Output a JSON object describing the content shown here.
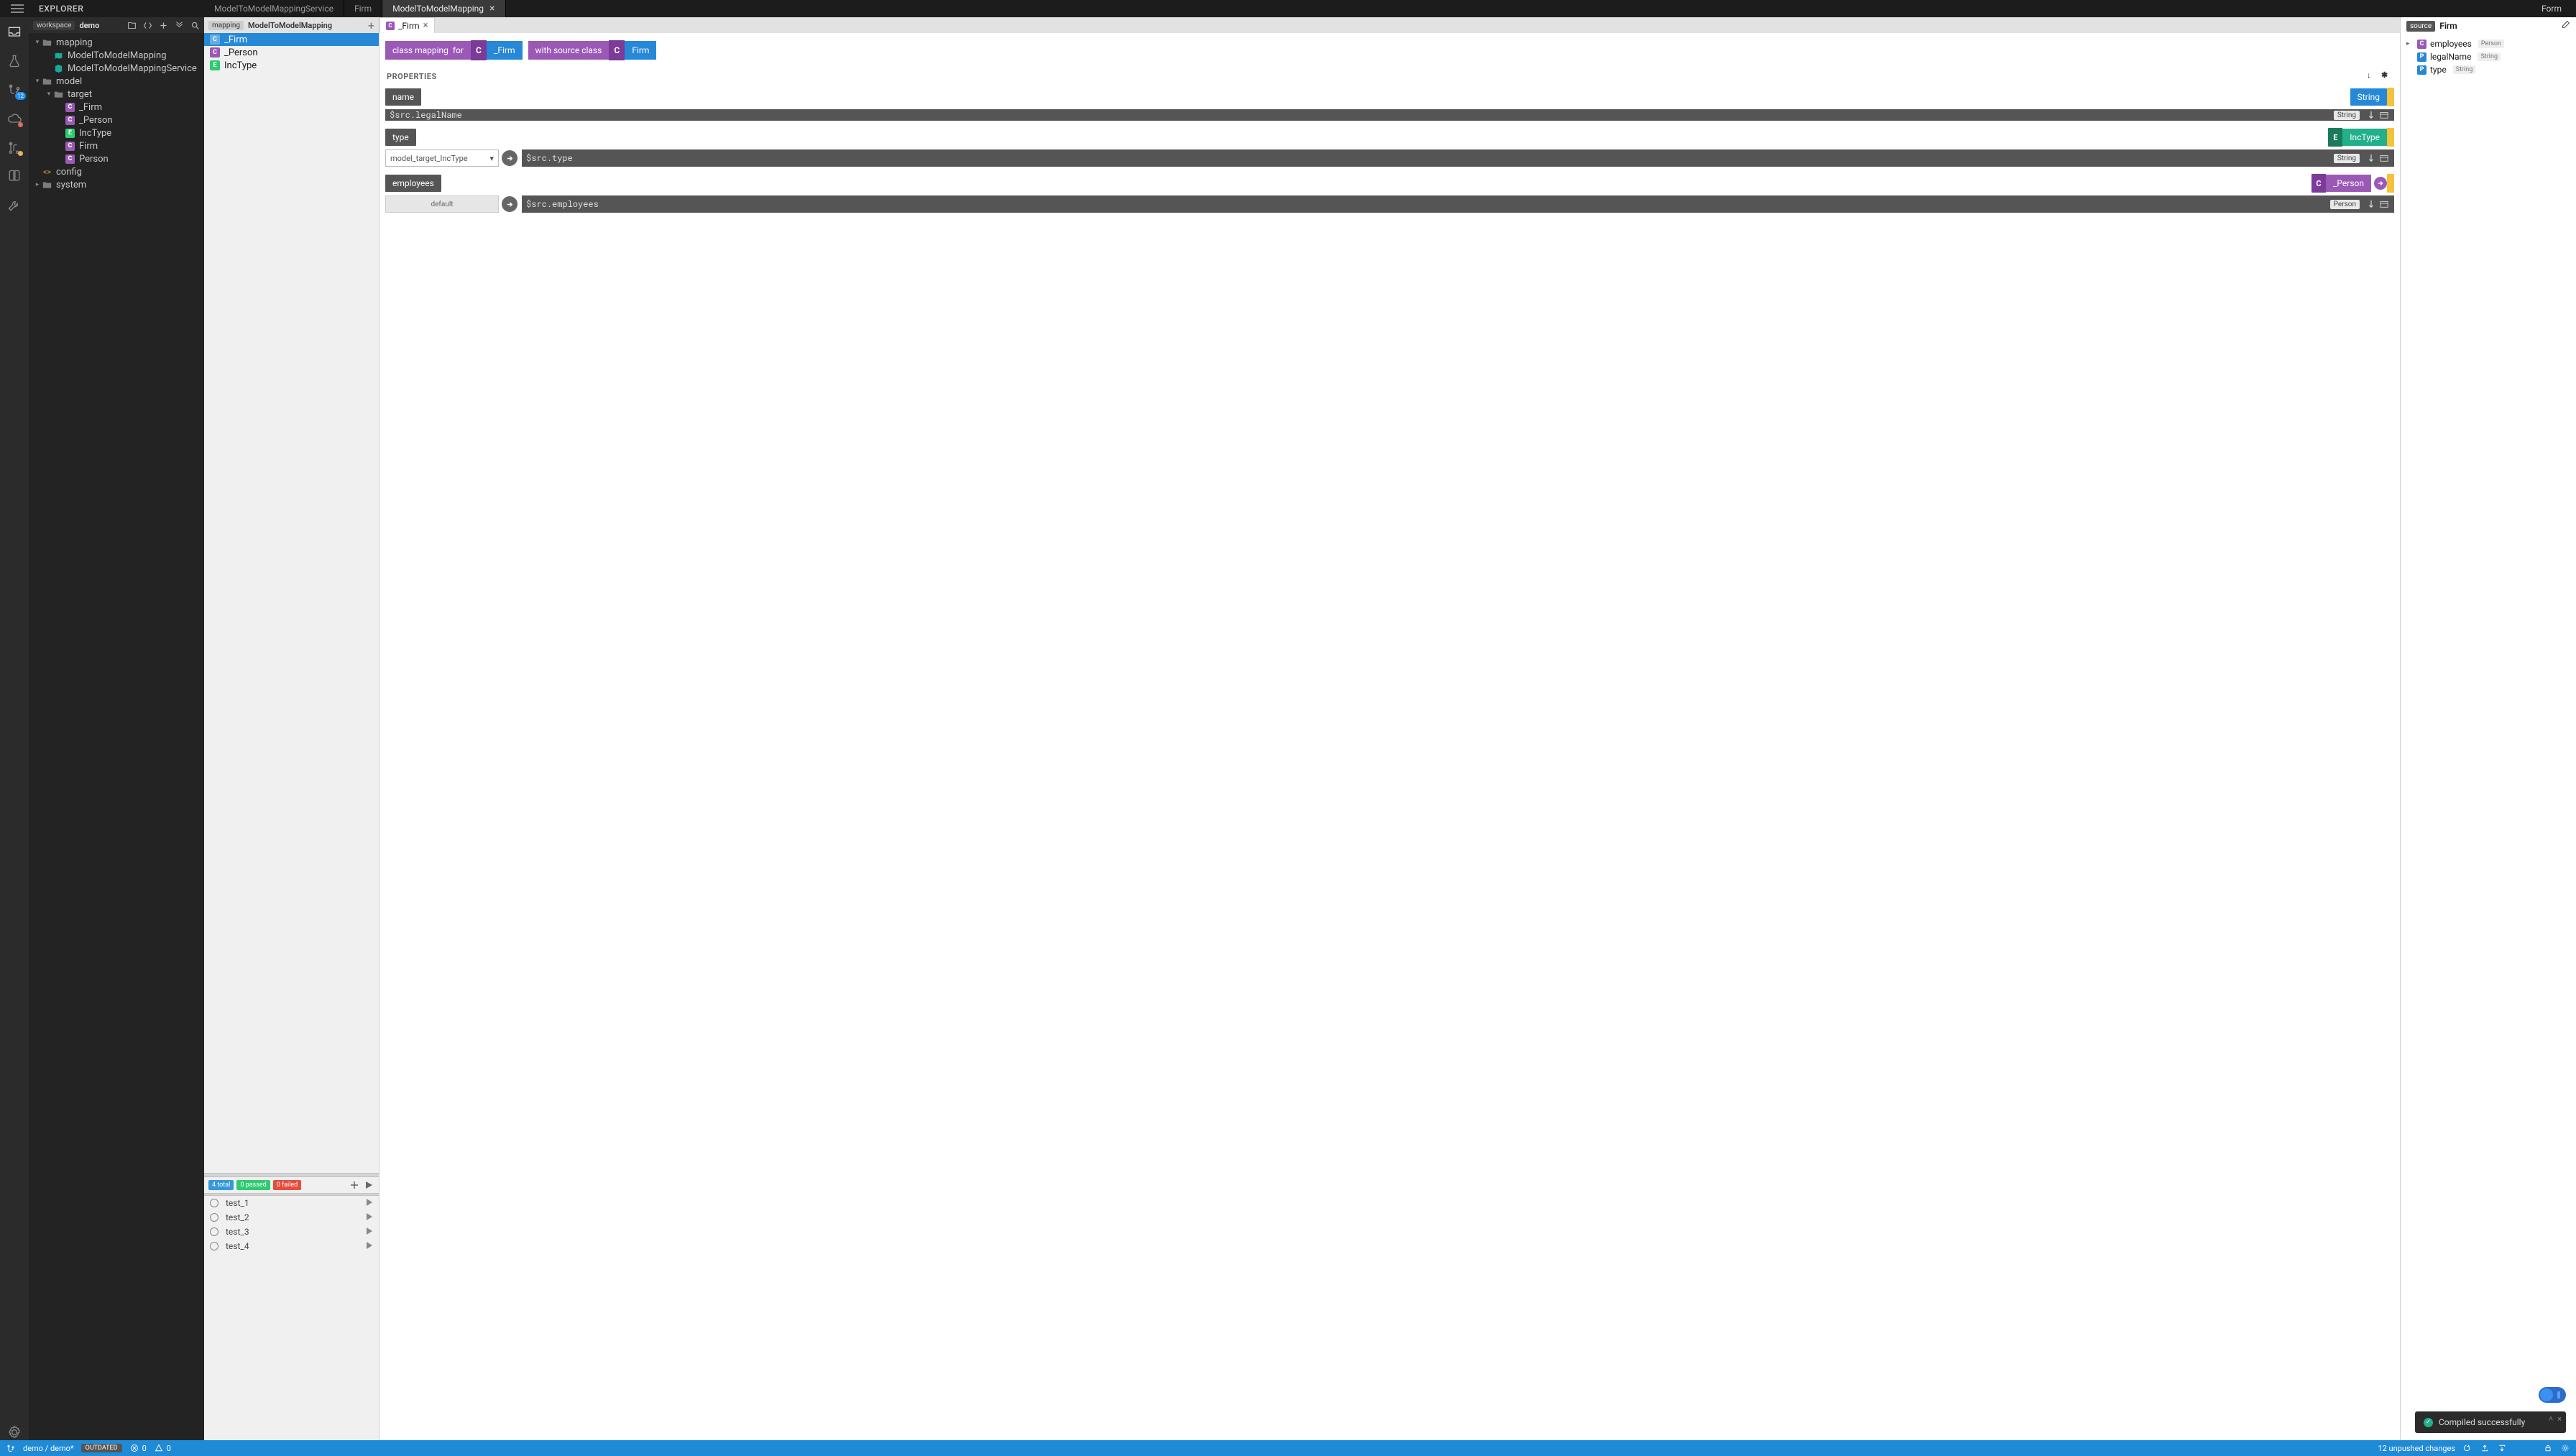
{
  "tabstrip": {
    "explorer_label": "EXPLORER",
    "tabs": [
      {
        "label": "ModelToModelMappingService",
        "active": false,
        "closeable": false
      },
      {
        "label": "Firm",
        "active": false,
        "closeable": false
      },
      {
        "label": "ModelToModelMapping",
        "active": true,
        "closeable": true
      }
    ],
    "right_label": "Form"
  },
  "workspace": {
    "pill": "workspace",
    "name": "demo"
  },
  "explorer_tree": [
    {
      "depth": 0,
      "twisty": "▾",
      "icon": "folder",
      "label": "mapping"
    },
    {
      "depth": 1,
      "twisty": "",
      "icon": "map",
      "label": "ModelToModelMapping"
    },
    {
      "depth": 1,
      "twisty": "",
      "icon": "svc",
      "label": "ModelToModelMappingService"
    },
    {
      "depth": 0,
      "twisty": "▾",
      "icon": "folder",
      "label": "model"
    },
    {
      "depth": 1,
      "twisty": "▾",
      "icon": "folder",
      "label": "target"
    },
    {
      "depth": 2,
      "twisty": "",
      "icon": "C",
      "label": "_Firm"
    },
    {
      "depth": 2,
      "twisty": "",
      "icon": "C",
      "label": "_Person"
    },
    {
      "depth": 2,
      "twisty": "",
      "icon": "E",
      "label": "IncType"
    },
    {
      "depth": 2,
      "twisty": "",
      "icon": "C",
      "label": "Firm"
    },
    {
      "depth": 2,
      "twisty": "",
      "icon": "C",
      "label": "Person"
    },
    {
      "depth": 0,
      "twisty": "",
      "icon": "fn",
      "label": "config"
    },
    {
      "depth": 0,
      "twisty": "▸",
      "icon": "folder",
      "label": "system"
    }
  ],
  "mapping_header": {
    "pill": "mapping",
    "name": "ModelToModelMapping"
  },
  "mapping_elements": [
    {
      "cls": "C",
      "label": "_Firm",
      "selected": true
    },
    {
      "cls": "C",
      "label": "_Person",
      "selected": false
    },
    {
      "cls": "E",
      "label": "IncType",
      "selected": false
    }
  ],
  "test_summary": {
    "total": "4 total",
    "passed": "0 passed",
    "failed": "0 failed"
  },
  "tests": [
    {
      "name": "test_1"
    },
    {
      "name": "test_2"
    },
    {
      "name": "test_3"
    },
    {
      "name": "test_4"
    }
  ],
  "editor": {
    "open_tab": {
      "cls": "C",
      "label": "_Firm"
    },
    "banner": {
      "left_lead": "class mapping",
      "left_trail": "for",
      "left_cls": "C",
      "left_name": "_Firm",
      "right_lead": "with source class",
      "right_cls": "C",
      "right_name": "Firm"
    },
    "properties_heading": "PROPERTIES",
    "props": [
      {
        "name": "name",
        "type_chip": {
          "style": "blue",
          "icon": "",
          "label": "String"
        },
        "pre": null,
        "expr": "$src.legalName",
        "expr_type": "String"
      },
      {
        "name": "type",
        "type_chip": {
          "style": "green",
          "icon": "E",
          "label": "IncType"
        },
        "pre": {
          "kind": "enum",
          "value": "model_target_IncType"
        },
        "expr": "$src.type",
        "expr_type": "String"
      },
      {
        "name": "employees",
        "type_chip": {
          "style": "purple",
          "icon": "C",
          "label": "_Person",
          "arrow": true
        },
        "pre": {
          "kind": "default",
          "value": "default"
        },
        "expr": "$src.employees",
        "expr_type": "Person"
      }
    ]
  },
  "source_panel": {
    "pill": "source",
    "name": "Firm",
    "tree": [
      {
        "tw": "▸",
        "cls": "C",
        "label": "employees",
        "ptype": "Person"
      },
      {
        "tw": "",
        "cls": "P",
        "label": "legalName",
        "ptype": "String"
      },
      {
        "tw": "",
        "cls": "P",
        "label": "type",
        "ptype": "String"
      }
    ]
  },
  "notification": {
    "message": "Compiled successfully"
  },
  "statusbar": {
    "branch_icon": true,
    "path": "demo / demo*",
    "outdated": "OUTDATED",
    "errors": "0",
    "warnings": "0",
    "unpushed": "12 unpushed changes"
  },
  "activity_badge": "12"
}
